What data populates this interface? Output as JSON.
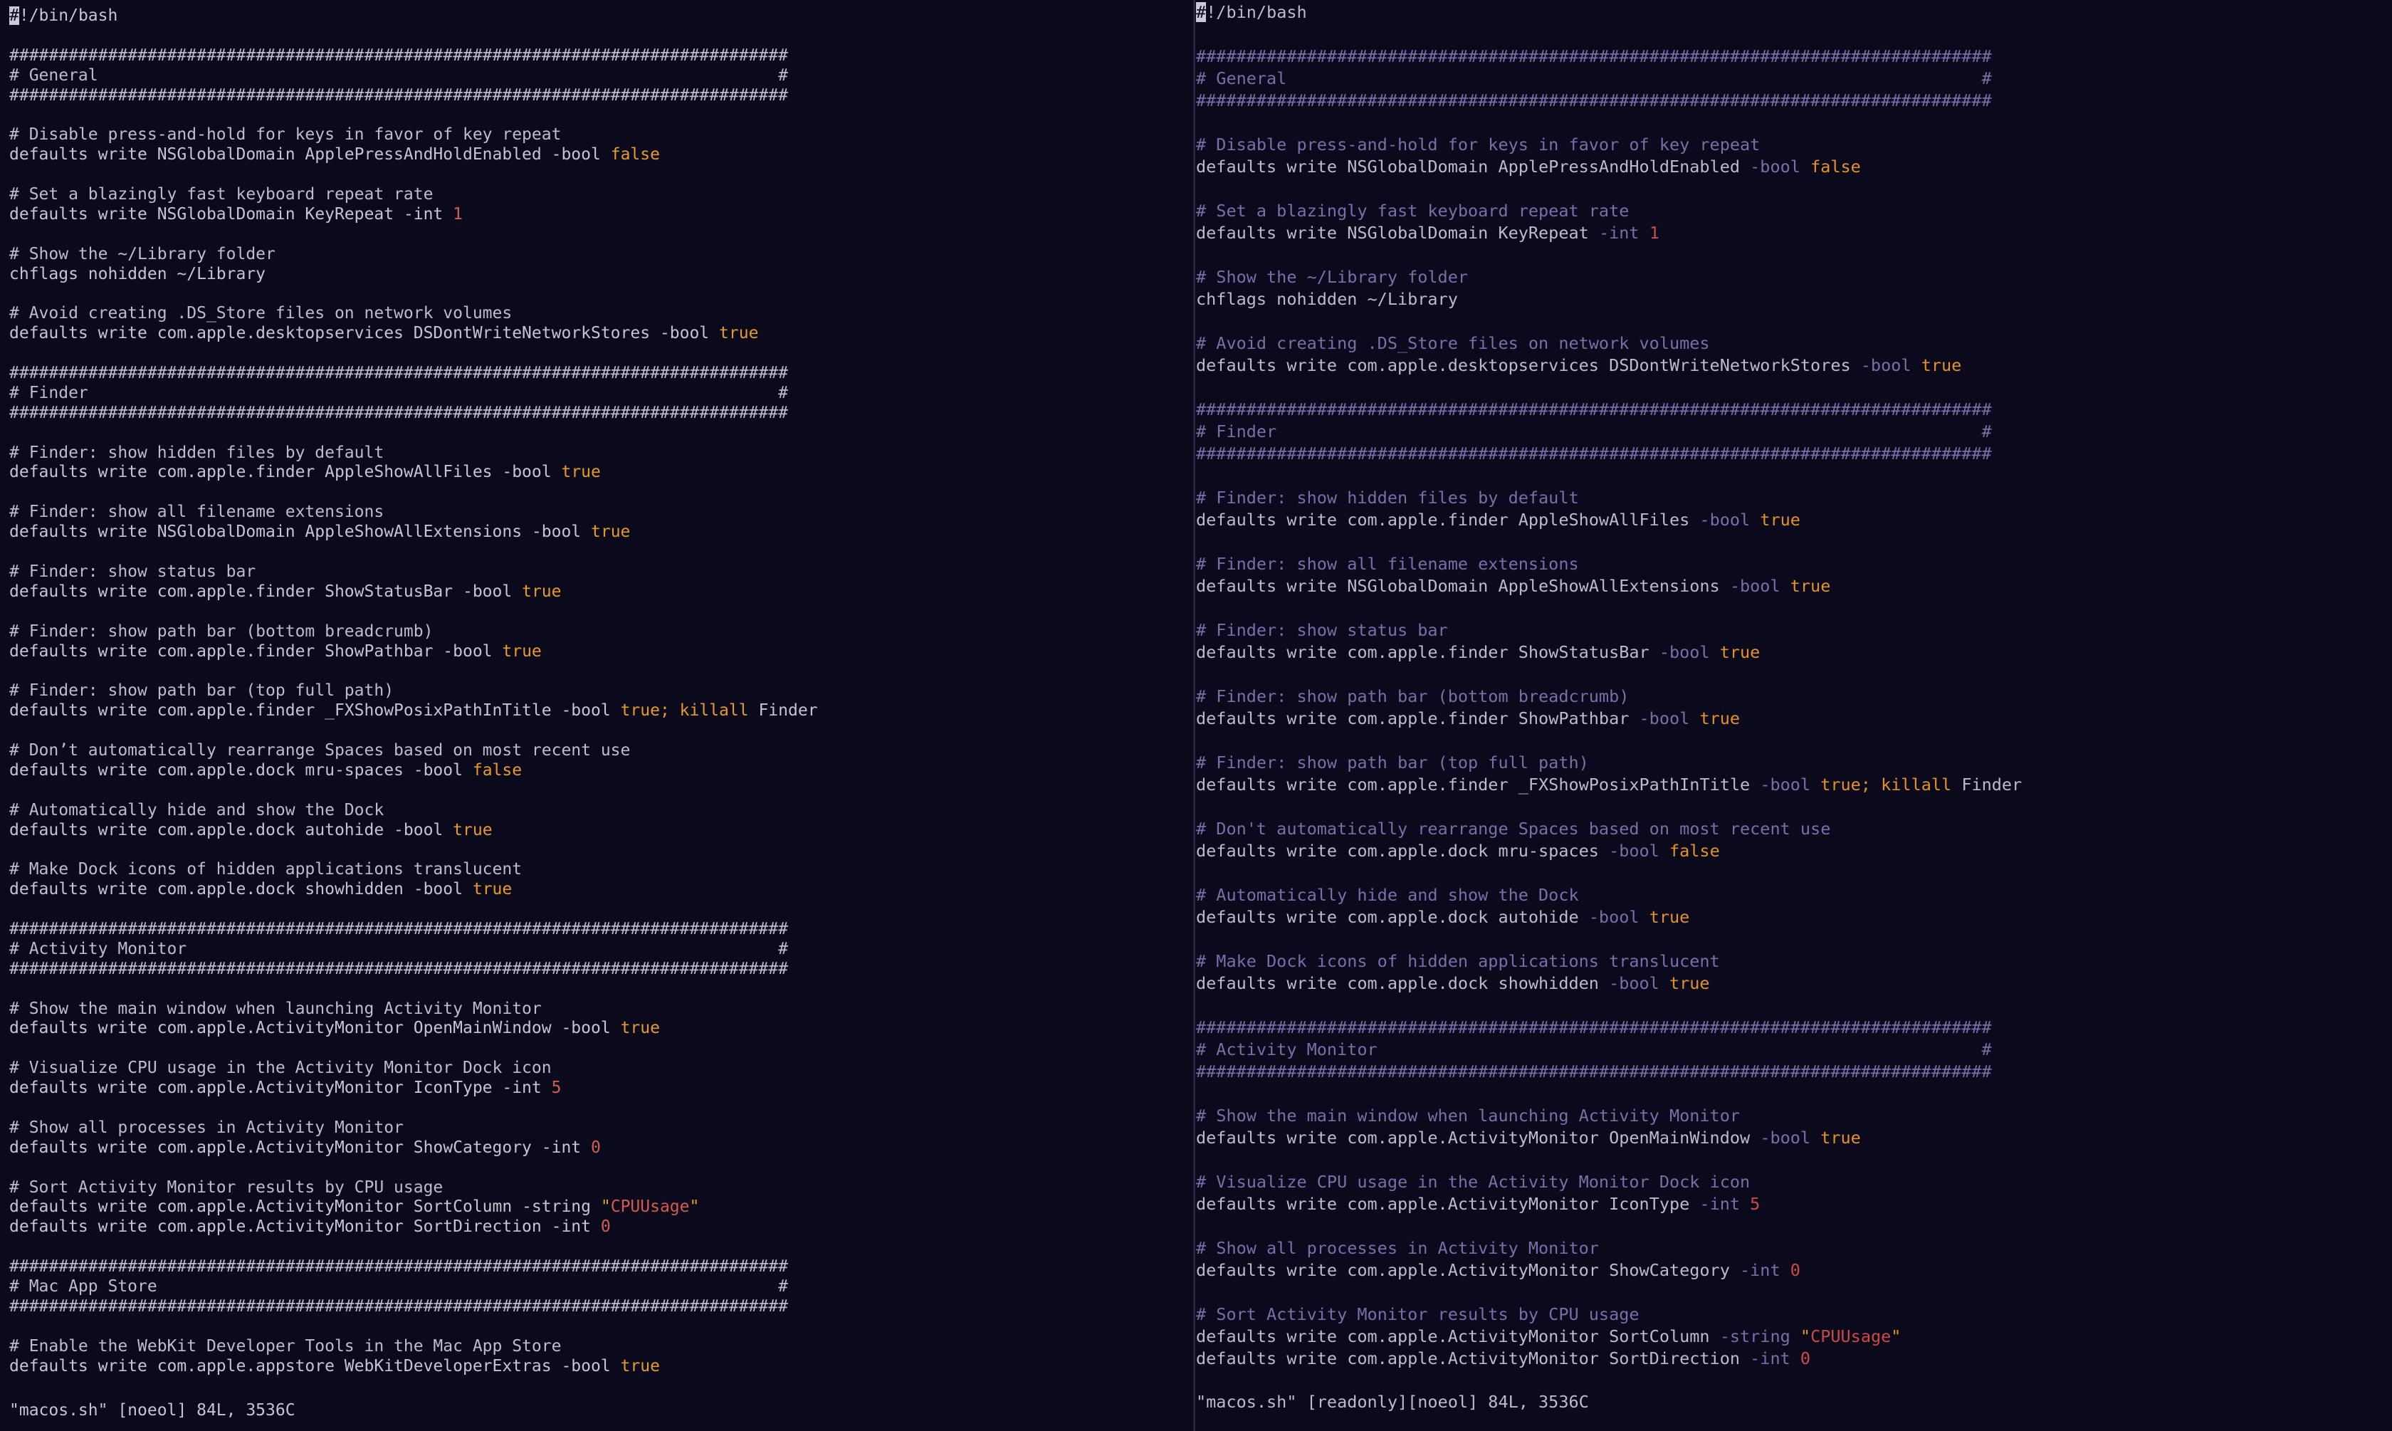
{
  "left": {
    "lines": [
      [
        {
          "t": "#",
          "c": "cursor"
        },
        {
          "t": "!/bin/bash"
        }
      ],
      [],
      [
        {
          "t": "###############################################################################",
          "c": "comment"
        }
      ],
      [
        {
          "t": "# General                                                                     #",
          "c": "comment"
        }
      ],
      [
        {
          "t": "###############################################################################",
          "c": "comment"
        }
      ],
      [],
      [
        {
          "t": "# Disable press-and-hold for keys in favor of key repeat",
          "c": "comment"
        }
      ],
      [
        {
          "t": "defaults write NSGlobalDomain ApplePressAndHoldEnabled "
        },
        {
          "t": "-bool",
          "c": "flag"
        },
        {
          "t": " "
        },
        {
          "t": "false",
          "c": "bool"
        }
      ],
      [],
      [
        {
          "t": "# Set a blazingly fast keyboard repeat rate",
          "c": "comment"
        }
      ],
      [
        {
          "t": "defaults write NSGlobalDomain KeyRepeat "
        },
        {
          "t": "-int",
          "c": "flag"
        },
        {
          "t": " "
        },
        {
          "t": "1",
          "c": "num"
        }
      ],
      [],
      [
        {
          "t": "# Show the ~/Library folder",
          "c": "comment"
        }
      ],
      [
        {
          "t": "chflags nohidden ~/Library"
        }
      ],
      [],
      [
        {
          "t": "# Avoid creating .DS_Store files on network volumes",
          "c": "comment"
        }
      ],
      [
        {
          "t": "defaults write com.apple.desktopservices DSDontWriteNetworkStores "
        },
        {
          "t": "-bool",
          "c": "flag"
        },
        {
          "t": " "
        },
        {
          "t": "true",
          "c": "bool"
        }
      ],
      [],
      [
        {
          "t": "###############################################################################",
          "c": "comment"
        }
      ],
      [
        {
          "t": "# Finder                                                                      #",
          "c": "comment"
        }
      ],
      [
        {
          "t": "###############################################################################",
          "c": "comment"
        }
      ],
      [],
      [
        {
          "t": "# Finder: show hidden files by default",
          "c": "comment"
        }
      ],
      [
        {
          "t": "defaults write com.apple.finder AppleShowAllFiles "
        },
        {
          "t": "-bool",
          "c": "flag"
        },
        {
          "t": " "
        },
        {
          "t": "true",
          "c": "bool"
        }
      ],
      [],
      [
        {
          "t": "# Finder: show all filename extensions",
          "c": "comment"
        }
      ],
      [
        {
          "t": "defaults write NSGlobalDomain AppleShowAllExtensions "
        },
        {
          "t": "-bool",
          "c": "flag"
        },
        {
          "t": " "
        },
        {
          "t": "true",
          "c": "bool"
        }
      ],
      [],
      [
        {
          "t": "# Finder: show status bar",
          "c": "comment"
        }
      ],
      [
        {
          "t": "defaults write com.apple.finder ShowStatusBar "
        },
        {
          "t": "-bool",
          "c": "flag"
        },
        {
          "t": " "
        },
        {
          "t": "true",
          "c": "bool"
        }
      ],
      [],
      [
        {
          "t": "# Finder: show path bar (bottom breadcrumb)",
          "c": "comment"
        }
      ],
      [
        {
          "t": "defaults write com.apple.finder ShowPathbar "
        },
        {
          "t": "-bool",
          "c": "flag"
        },
        {
          "t": " "
        },
        {
          "t": "true",
          "c": "bool"
        }
      ],
      [],
      [
        {
          "t": "# Finder: show path bar (top full path)",
          "c": "comment"
        }
      ],
      [
        {
          "t": "defaults write com.apple.finder _FXShowPosixPathInTitle "
        },
        {
          "t": "-bool",
          "c": "flag"
        },
        {
          "t": " "
        },
        {
          "t": "true;",
          "c": "bool"
        },
        {
          "t": " "
        },
        {
          "t": "killall",
          "c": "kw"
        },
        {
          "t": " Finder"
        }
      ],
      [],
      [
        {
          "t": "# Don’t automatically rearrange Spaces based on most recent use",
          "c": "comment"
        }
      ],
      [
        {
          "t": "defaults write com.apple.dock mru-spaces "
        },
        {
          "t": "-bool",
          "c": "flag"
        },
        {
          "t": " "
        },
        {
          "t": "false",
          "c": "bool"
        }
      ],
      [],
      [
        {
          "t": "# Automatically hide and show the Dock",
          "c": "comment"
        }
      ],
      [
        {
          "t": "defaults write com.apple.dock autohide "
        },
        {
          "t": "-bool",
          "c": "flag"
        },
        {
          "t": " "
        },
        {
          "t": "true",
          "c": "bool"
        }
      ],
      [],
      [
        {
          "t": "# Make Dock icons of hidden applications translucent",
          "c": "comment"
        }
      ],
      [
        {
          "t": "defaults write com.apple.dock showhidden "
        },
        {
          "t": "-bool",
          "c": "flag"
        },
        {
          "t": " "
        },
        {
          "t": "true",
          "c": "bool"
        }
      ],
      [],
      [
        {
          "t": "###############################################################################",
          "c": "comment"
        }
      ],
      [
        {
          "t": "# Activity Monitor                                                            #",
          "c": "comment"
        }
      ],
      [
        {
          "t": "###############################################################################",
          "c": "comment"
        }
      ],
      [],
      [
        {
          "t": "# Show the main window when launching Activity Monitor",
          "c": "comment"
        }
      ],
      [
        {
          "t": "defaults write com.apple.ActivityMonitor OpenMainWindow "
        },
        {
          "t": "-bool",
          "c": "flag"
        },
        {
          "t": " "
        },
        {
          "t": "true",
          "c": "bool"
        }
      ],
      [],
      [
        {
          "t": "# Visualize CPU usage in the Activity Monitor Dock icon",
          "c": "comment"
        }
      ],
      [
        {
          "t": "defaults write com.apple.ActivityMonitor IconType "
        },
        {
          "t": "-int",
          "c": "flag"
        },
        {
          "t": " "
        },
        {
          "t": "5",
          "c": "num"
        }
      ],
      [],
      [
        {
          "t": "# Show all processes in Activity Monitor",
          "c": "comment"
        }
      ],
      [
        {
          "t": "defaults write com.apple.ActivityMonitor ShowCategory "
        },
        {
          "t": "-int",
          "c": "flag"
        },
        {
          "t": " "
        },
        {
          "t": "0",
          "c": "num"
        }
      ],
      [],
      [
        {
          "t": "# Sort Activity Monitor results by CPU usage",
          "c": "comment"
        }
      ],
      [
        {
          "t": "defaults write com.apple.ActivityMonitor SortColumn "
        },
        {
          "t": "-string",
          "c": "flag"
        },
        {
          "t": " "
        },
        {
          "t": "\"",
          "c": "str-q"
        },
        {
          "t": "CPUUsage",
          "c": "str"
        },
        {
          "t": "\"",
          "c": "str-q"
        }
      ],
      [
        {
          "t": "defaults write com.apple.ActivityMonitor SortDirection "
        },
        {
          "t": "-int",
          "c": "flag"
        },
        {
          "t": " "
        },
        {
          "t": "0",
          "c": "num"
        }
      ],
      [],
      [
        {
          "t": "###############################################################################",
          "c": "comment"
        }
      ],
      [
        {
          "t": "# Mac App Store                                                               #",
          "c": "comment"
        }
      ],
      [
        {
          "t": "###############################################################################",
          "c": "comment"
        }
      ],
      [],
      [
        {
          "t": "# Enable the WebKit Developer Tools in the Mac App Store",
          "c": "comment"
        }
      ],
      [
        {
          "t": "defaults write com.apple.appstore WebKitDeveloperExtras "
        },
        {
          "t": "-bool",
          "c": "flag"
        },
        {
          "t": " "
        },
        {
          "t": "true",
          "c": "bool"
        }
      ]
    ],
    "status": "\"macos.sh\" [noeol] 84L, 3536C"
  },
  "right": {
    "lines": [
      [
        {
          "t": "#",
          "c": "cursor"
        },
        {
          "t": "!/bin/bash"
        }
      ],
      [],
      [
        {
          "t": "###############################################################################",
          "c": "comment"
        }
      ],
      [
        {
          "t": "# General                                                                     #",
          "c": "comment"
        }
      ],
      [
        {
          "t": "###############################################################################",
          "c": "comment"
        }
      ],
      [],
      [
        {
          "t": "# Disable press-and-hold for keys in favor of key repeat",
          "c": "comment"
        }
      ],
      [
        {
          "t": "defaults write NSGlobalDomain ApplePressAndHoldEnabled "
        },
        {
          "t": "-bool",
          "c": "flag"
        },
        {
          "t": " "
        },
        {
          "t": "false",
          "c": "bool"
        }
      ],
      [],
      [
        {
          "t": "# Set a blazingly fast keyboard repeat rate",
          "c": "comment"
        }
      ],
      [
        {
          "t": "defaults write NSGlobalDomain KeyRepeat "
        },
        {
          "t": "-int",
          "c": "flag"
        },
        {
          "t": " "
        },
        {
          "t": "1",
          "c": "num"
        }
      ],
      [],
      [
        {
          "t": "# Show the ~/Library folder",
          "c": "comment"
        }
      ],
      [
        {
          "t": "chflags nohidden ~/Library"
        }
      ],
      [],
      [
        {
          "t": "# Avoid creating .DS_Store files on network volumes",
          "c": "comment"
        }
      ],
      [
        {
          "t": "defaults write com.apple.desktopservices DSDontWriteNetworkStores "
        },
        {
          "t": "-bool",
          "c": "flag"
        },
        {
          "t": " "
        },
        {
          "t": "true",
          "c": "bool"
        }
      ],
      [],
      [
        {
          "t": "###############################################################################",
          "c": "comment"
        }
      ],
      [
        {
          "t": "# Finder                                                                      #",
          "c": "comment"
        }
      ],
      [
        {
          "t": "###############################################################################",
          "c": "comment"
        }
      ],
      [],
      [
        {
          "t": "# Finder: show hidden files by default",
          "c": "comment"
        }
      ],
      [
        {
          "t": "defaults write com.apple.finder AppleShowAllFiles "
        },
        {
          "t": "-bool",
          "c": "flag"
        },
        {
          "t": " "
        },
        {
          "t": "true",
          "c": "bool"
        }
      ],
      [],
      [
        {
          "t": "# Finder: show all filename extensions",
          "c": "comment"
        }
      ],
      [
        {
          "t": "defaults write NSGlobalDomain AppleShowAllExtensions "
        },
        {
          "t": "-bool",
          "c": "flag"
        },
        {
          "t": " "
        },
        {
          "t": "true",
          "c": "bool"
        }
      ],
      [],
      [
        {
          "t": "# Finder: show status bar",
          "c": "comment"
        }
      ],
      [
        {
          "t": "defaults write com.apple.finder ShowStatusBar "
        },
        {
          "t": "-bool",
          "c": "flag"
        },
        {
          "t": " "
        },
        {
          "t": "true",
          "c": "bool"
        }
      ],
      [],
      [
        {
          "t": "# Finder: show path bar (bottom breadcrumb)",
          "c": "comment"
        }
      ],
      [
        {
          "t": "defaults write com.apple.finder ShowPathbar "
        },
        {
          "t": "-bool",
          "c": "flag"
        },
        {
          "t": " "
        },
        {
          "t": "true",
          "c": "bool"
        }
      ],
      [],
      [
        {
          "t": "# Finder: show path bar (top full path)",
          "c": "comment"
        }
      ],
      [
        {
          "t": "defaults write com.apple.finder _FXShowPosixPathInTitle "
        },
        {
          "t": "-bool",
          "c": "flag"
        },
        {
          "t": " "
        },
        {
          "t": "true;",
          "c": "bool"
        },
        {
          "t": " "
        },
        {
          "t": "killall",
          "c": "kw"
        },
        {
          "t": " Finder"
        }
      ],
      [],
      [
        {
          "t": "# Don't automatically rearrange Spaces based on most recent use",
          "c": "comment"
        }
      ],
      [
        {
          "t": "defaults write com.apple.dock mru-spaces "
        },
        {
          "t": "-bool",
          "c": "flag"
        },
        {
          "t": " "
        },
        {
          "t": "false",
          "c": "bool"
        }
      ],
      [],
      [
        {
          "t": "# Automatically hide and show the Dock",
          "c": "comment"
        }
      ],
      [
        {
          "t": "defaults write com.apple.dock autohide "
        },
        {
          "t": "-bool",
          "c": "flag"
        },
        {
          "t": " "
        },
        {
          "t": "true",
          "c": "bool"
        }
      ],
      [],
      [
        {
          "t": "# Make Dock icons of hidden applications translucent",
          "c": "comment"
        }
      ],
      [
        {
          "t": "defaults write com.apple.dock showhidden "
        },
        {
          "t": "-bool",
          "c": "flag"
        },
        {
          "t": " "
        },
        {
          "t": "true",
          "c": "bool"
        }
      ],
      [],
      [
        {
          "t": "###############################################################################",
          "c": "comment"
        }
      ],
      [
        {
          "t": "# Activity Monitor                                                            #",
          "c": "comment"
        }
      ],
      [
        {
          "t": "###############################################################################",
          "c": "comment"
        }
      ],
      [],
      [
        {
          "t": "# Show the main window when launching Activity Monitor",
          "c": "comment"
        }
      ],
      [
        {
          "t": "defaults write com.apple.ActivityMonitor OpenMainWindow "
        },
        {
          "t": "-bool",
          "c": "flag"
        },
        {
          "t": " "
        },
        {
          "t": "true",
          "c": "bool"
        }
      ],
      [],
      [
        {
          "t": "# Visualize CPU usage in the Activity Monitor Dock icon",
          "c": "comment"
        }
      ],
      [
        {
          "t": "defaults write com.apple.ActivityMonitor IconType "
        },
        {
          "t": "-int",
          "c": "flag"
        },
        {
          "t": " "
        },
        {
          "t": "5",
          "c": "num"
        }
      ],
      [],
      [
        {
          "t": "# Show all processes in Activity Monitor",
          "c": "comment"
        }
      ],
      [
        {
          "t": "defaults write com.apple.ActivityMonitor ShowCategory "
        },
        {
          "t": "-int",
          "c": "flag"
        },
        {
          "t": " "
        },
        {
          "t": "0",
          "c": "num"
        }
      ],
      [],
      [
        {
          "t": "# Sort Activity Monitor results by CPU usage",
          "c": "comment"
        }
      ],
      [
        {
          "t": "defaults write com.apple.ActivityMonitor SortColumn "
        },
        {
          "t": "-string",
          "c": "flag"
        },
        {
          "t": " "
        },
        {
          "t": "\"",
          "c": "str-q"
        },
        {
          "t": "CPUUsage",
          "c": "str"
        },
        {
          "t": "\"",
          "c": "str-q"
        }
      ],
      [
        {
          "t": "defaults write com.apple.ActivityMonitor SortDirection "
        },
        {
          "t": "-int",
          "c": "flag"
        },
        {
          "t": " "
        },
        {
          "t": "0",
          "c": "num"
        }
      ]
    ],
    "status": "\"macos.sh\" [readonly][noeol] 84L, 3536C"
  }
}
